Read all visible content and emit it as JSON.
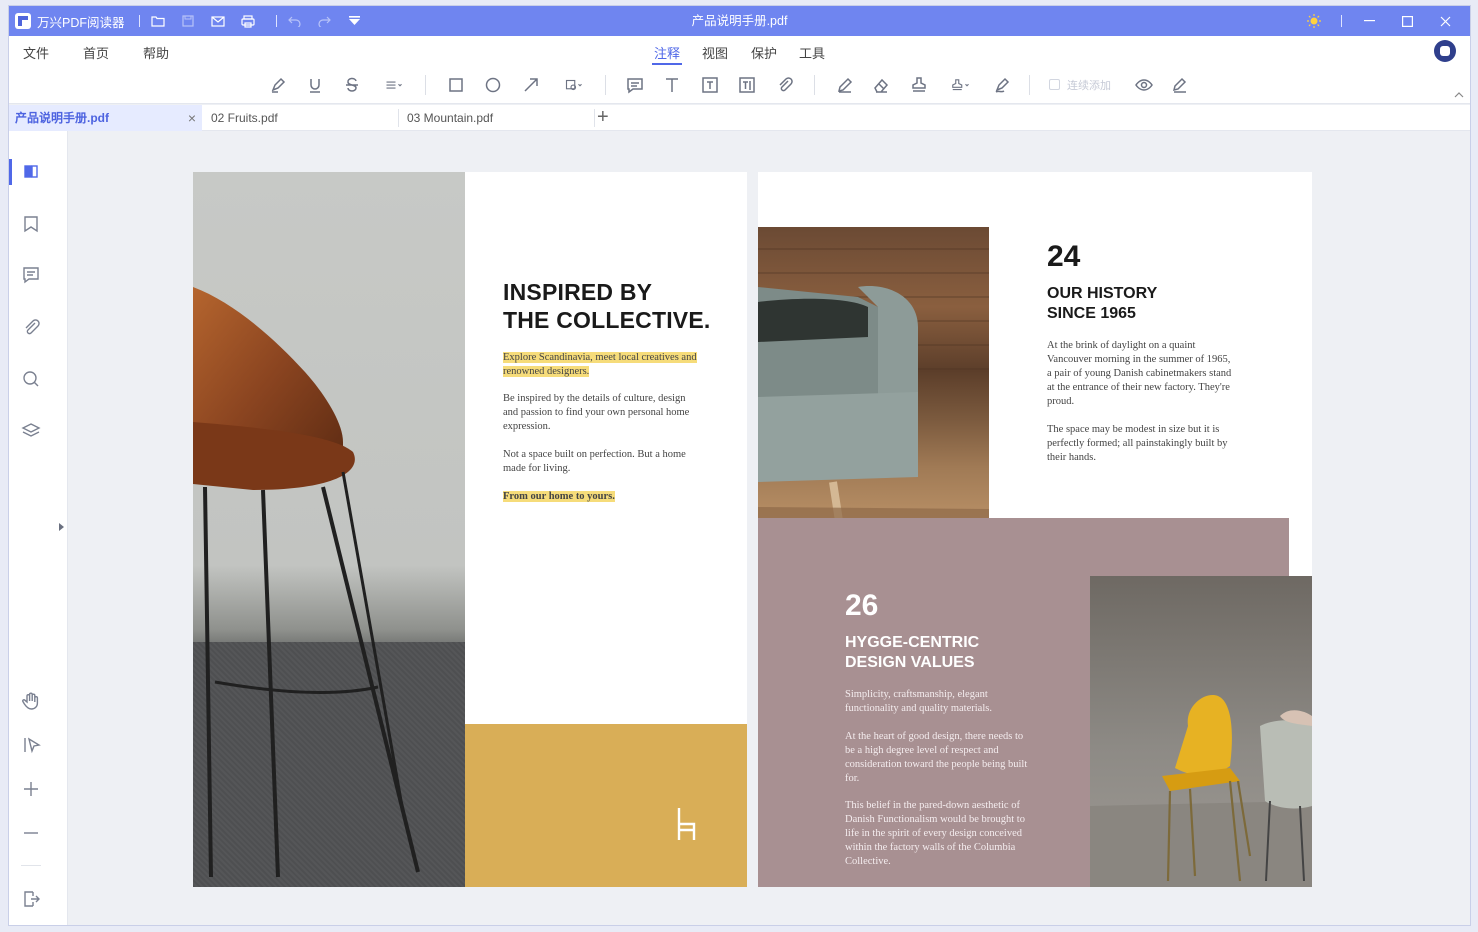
{
  "app": {
    "name": "万兴PDF阅读器",
    "document_title": "产品说明手册.pdf"
  },
  "menu": {
    "file": "文件",
    "home": "首页",
    "help": "帮助"
  },
  "ribbon_tabs": {
    "annotate": "注释",
    "view": "视图",
    "protect": "保护",
    "tools": "工具"
  },
  "toolbar": {
    "continuous_add": "连续添加"
  },
  "tabs": [
    {
      "label": "产品说明手册.pdf"
    },
    {
      "label": "02 Fruits.pdf"
    },
    {
      "label": "03 Mountain.pdf"
    }
  ],
  "page1": {
    "title_line1": "INSPIRED BY",
    "title_line2": "THE COLLECTIVE.",
    "highlight1": "Explore Scandinavia, meet local creatives and renowned designers.",
    "para1": "Be inspired by the details of culture, design and passion to find your own personal home expression.",
    "para2": "Not a space built on perfection. But a home made for living.",
    "highlight2": "From our home to yours."
  },
  "page2": {
    "num1": "24",
    "heading1_line1": "OUR HISTORY",
    "heading1_line2": "SINCE 1965",
    "body1": "At the brink of daylight on a quaint Vancouver morning in the summer of 1965, a pair of young Danish cabinetmakers stand at the entrance of their new factory. They're proud.",
    "body2": "The space may be modest in size but it is perfectly formed; all painstakingly built by their hands.",
    "num2": "26",
    "heading2_line1": "HYGGE-CENTRIC",
    "heading2_line2": "DESIGN VALUES",
    "body3": "Simplicity, craftsmanship, elegant functionality and quality materials.",
    "body4": "At the heart of good design, there needs to be a high degree level of respect and consideration toward the people being built for.",
    "body5": "This belief in the pared-down aesthetic of Danish Functionalism would be brought to life in the spirit of every design conceived within the factory walls of the Columbia Collective."
  },
  "colors": {
    "titlebar": "#6f85f0",
    "accent": "#5068e8",
    "gold": "#d9ae57",
    "mauve": "#a89092"
  }
}
